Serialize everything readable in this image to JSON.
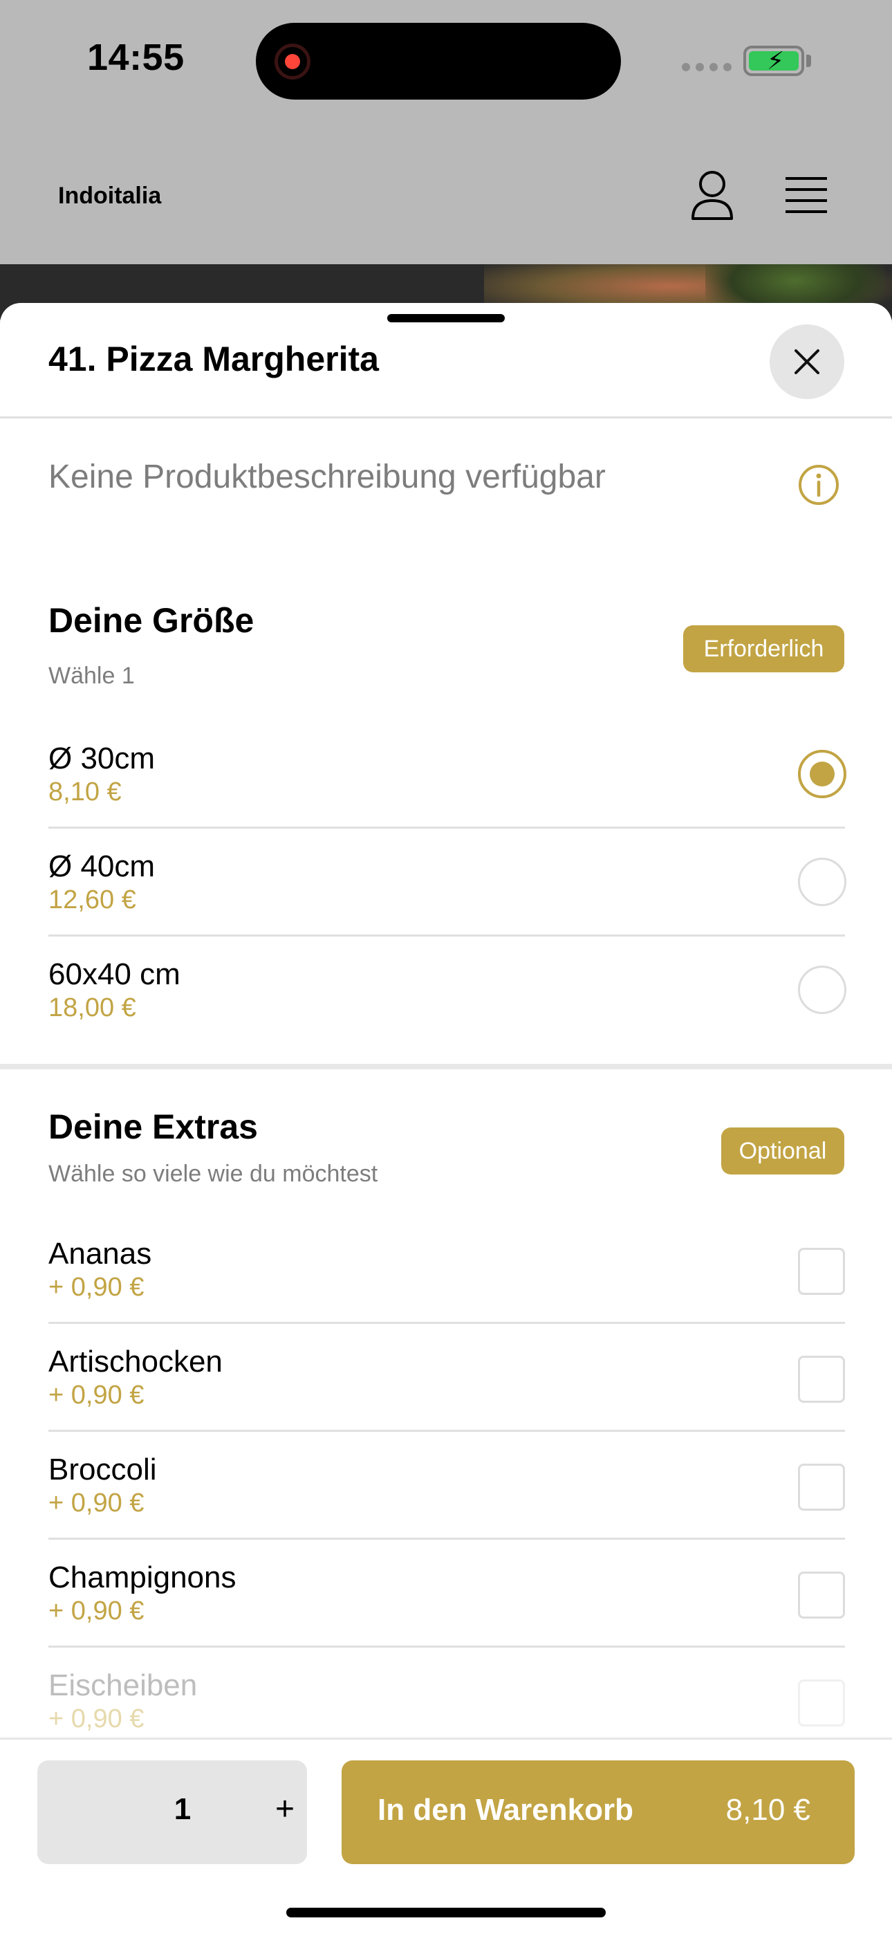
{
  "status_bar": {
    "time": "14:55",
    "battery_color": "#34c759",
    "icons": [
      "recording-icon",
      "signal-icon",
      "battery-icon"
    ]
  },
  "header": {
    "brand": "Indoitalia",
    "icons": [
      "user-icon",
      "menu-icon"
    ]
  },
  "product": {
    "title": "41. Pizza Margherita",
    "description": "Keine Produktbeschreibung verfügbar"
  },
  "size_section": {
    "title": "Deine Größe",
    "subtitle": "Wähle 1",
    "badge": "Erforderlich",
    "options": [
      {
        "name": "Ø 30cm",
        "price": "8,10 €",
        "selected": true
      },
      {
        "name": "Ø 40cm",
        "price": "12,60 €",
        "selected": false
      },
      {
        "name": "60x40 cm",
        "price": "18,00 €",
        "selected": false
      }
    ]
  },
  "extras_section": {
    "title": "Deine Extras",
    "subtitle": "Wähle so viele wie du möchtest",
    "badge": "Optional",
    "options": [
      {
        "name": "Ananas",
        "price": "+ 0,90 €"
      },
      {
        "name": "Artischocken",
        "price": "+ 0,90 €"
      },
      {
        "name": "Broccoli",
        "price": "+ 0,90 €"
      },
      {
        "name": "Champignons",
        "price": "+ 0,90 €"
      },
      {
        "name": "Eischeiben",
        "price": "+ 0,90 €"
      }
    ]
  },
  "footer": {
    "quantity": "1",
    "plus": "+",
    "cart_label": "In den Warenkorb",
    "cart_price": "8,10 €"
  },
  "colors": {
    "accent": "#c2a444",
    "dim_background": "#b9b9b9"
  }
}
